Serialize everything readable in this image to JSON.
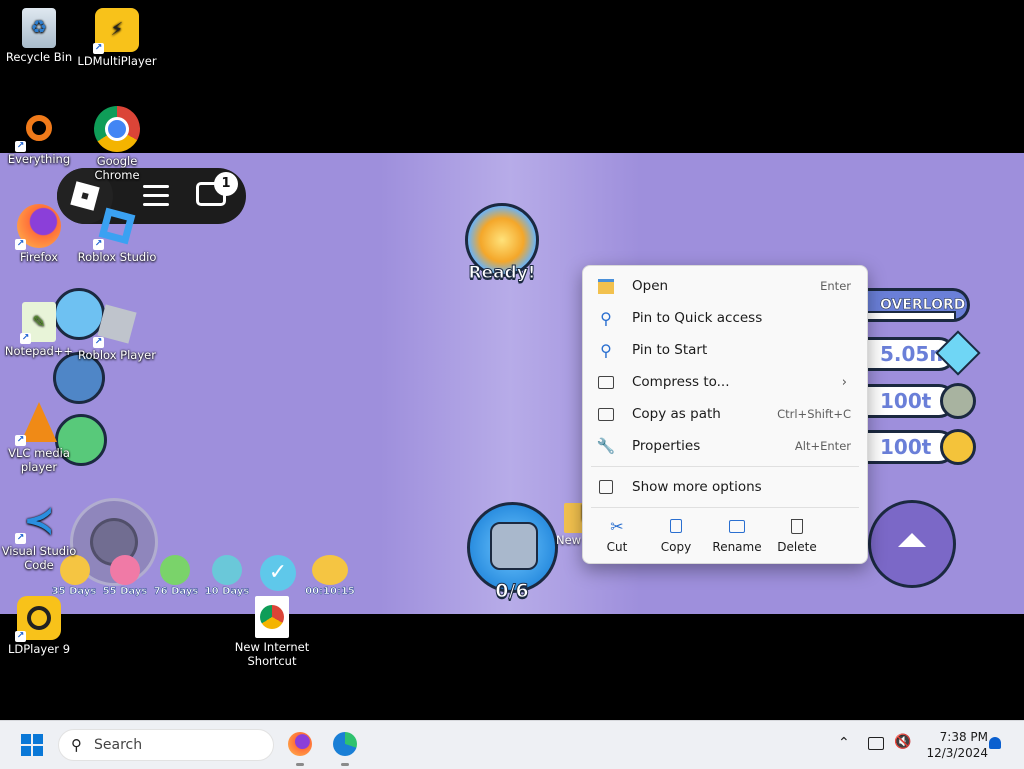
{
  "desktop_icons": [
    {
      "label": "Recycle Bin",
      "icon": "recycle-bin-icon"
    },
    {
      "label": "LDMultiPlayer",
      "icon": "ldmultiplayer-icon"
    },
    {
      "label": "Everything",
      "icon": "everything-search-icon"
    },
    {
      "label": "Google Chrome",
      "icon": "chrome-icon"
    },
    {
      "label": "Firefox",
      "icon": "firefox-icon"
    },
    {
      "label": "Roblox Studio",
      "icon": "roblox-studio-icon"
    },
    {
      "label": "Notepad++",
      "icon": "notepadpp-icon"
    },
    {
      "label": "Roblox Player",
      "icon": "roblox-player-icon"
    },
    {
      "label": "VLC media player",
      "icon": "vlc-icon"
    },
    {
      "label": "Visual Studio Code",
      "icon": "vscode-icon"
    },
    {
      "label": "LDPlayer 9",
      "icon": "ldplayer-icon"
    },
    {
      "label": "New Internet Shortcut",
      "icon": "internet-shortcut-icon"
    },
    {
      "label": "New",
      "icon": "folder-icon"
    }
  ],
  "roblox": {
    "chat_badge": "1",
    "gift_label": "Ready!",
    "pet_counter": "0/6",
    "rank": "OVERLORD",
    "gems": "5.05m",
    "currency_1": "100t",
    "currency_2": "100t",
    "timers": [
      "35 Days",
      "55 Days",
      "76 Days",
      "10 Days",
      "",
      "00:10:15"
    ]
  },
  "context_menu": {
    "items": [
      {
        "label": "Open",
        "shortcut": "Enter",
        "icon": "open-icon"
      },
      {
        "label": "Pin to Quick access",
        "shortcut": "",
        "icon": "pin-icon"
      },
      {
        "label": "Pin to Start",
        "shortcut": "",
        "icon": "pin-icon"
      },
      {
        "label": "Compress to...",
        "shortcut": "",
        "icon": "zip-folder-icon"
      },
      {
        "label": "Copy as path",
        "shortcut": "Ctrl+Shift+C",
        "icon": "copy-path-icon"
      },
      {
        "label": "Properties",
        "shortcut": "Alt+Enter",
        "icon": "wrench-icon"
      }
    ],
    "more": "Show more options",
    "actions": [
      {
        "label": "Cut",
        "icon": "scissors-icon"
      },
      {
        "label": "Copy",
        "icon": "copy-icon"
      },
      {
        "label": "Rename",
        "icon": "rename-icon"
      },
      {
        "label": "Delete",
        "icon": "trash-icon"
      }
    ]
  },
  "taskbar": {
    "search_placeholder": "Search",
    "time": "7:38 PM",
    "date": "12/3/2024"
  },
  "colors": {
    "game_bg": "#9e8fdc",
    "accent": "#0067c0",
    "taskbar": "#eef0f4"
  }
}
